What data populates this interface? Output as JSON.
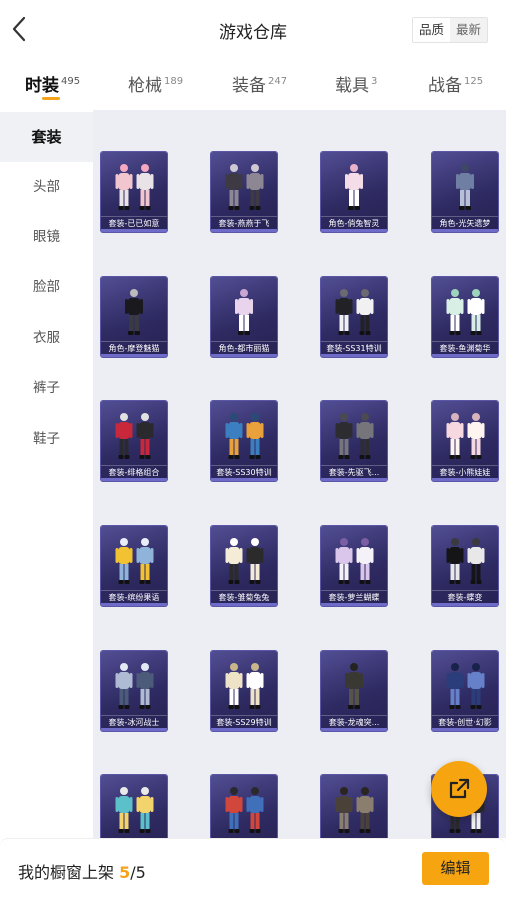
{
  "header": {
    "title": "游戏仓库",
    "sort_options": [
      "品质",
      "最新"
    ],
    "active_sort": 0
  },
  "tabs": [
    {
      "label": "时装",
      "count": "495",
      "active": true
    },
    {
      "label": "枪械",
      "count": "189",
      "active": false
    },
    {
      "label": "装备",
      "count": "247",
      "active": false
    },
    {
      "label": "载具",
      "count": "3",
      "active": false
    },
    {
      "label": "战备",
      "count": "125",
      "active": false
    }
  ],
  "sidebar": {
    "items": [
      {
        "label": "套装",
        "active": true
      },
      {
        "label": "头部",
        "active": false
      },
      {
        "label": "眼镜",
        "active": false
      },
      {
        "label": "脸部",
        "active": false
      },
      {
        "label": "衣服",
        "active": false
      },
      {
        "label": "裤子",
        "active": false
      },
      {
        "label": "鞋子",
        "active": false
      }
    ]
  },
  "items": [
    {
      "label": "套装-已已如意",
      "icon": "twin-outfit-pink"
    },
    {
      "label": "套装-燕燕于飞",
      "icon": "twin-outfit-dark"
    },
    {
      "label": "角色-俏兔智灵",
      "icon": "single-character-bunny"
    },
    {
      "label": "角色-光矢遗梦",
      "icon": "single-character-knight"
    },
    {
      "label": "角色-摩登魅猫",
      "icon": "single-character-black-cat"
    },
    {
      "label": "角色-都市丽猫",
      "icon": "single-character-dress"
    },
    {
      "label": "套装-SS31特训",
      "icon": "twin-outfit-mono"
    },
    {
      "label": "套装-鱼渊菊华",
      "icon": "twin-outfit-mint"
    },
    {
      "label": "套装-绯格组合",
      "icon": "outfit-set-red"
    },
    {
      "label": "套装-SS30特训",
      "icon": "twin-outfit-blue"
    },
    {
      "label": "套装-先驱飞...",
      "icon": "twin-outfit-armor"
    },
    {
      "label": "套装-小熊娃娃",
      "icon": "twin-outfit-pastel"
    },
    {
      "label": "套装-缤纷果语",
      "icon": "outfit-set-yellow"
    },
    {
      "label": "套装-雏菊兔兔",
      "icon": "twin-outfit-cream"
    },
    {
      "label": "套装-萝兰蝴蝶",
      "icon": "twin-outfit-lilac"
    },
    {
      "label": "套装-蝶变",
      "icon": "twin-outfit-black"
    },
    {
      "label": "套装-冰河战士",
      "icon": "twin-outfit-ice"
    },
    {
      "label": "套装-SS29特训",
      "icon": "outfit-set-beige"
    },
    {
      "label": "套装-龙魂突...",
      "icon": "single-character-soldier"
    },
    {
      "label": "套装-创世·幻影",
      "icon": "twin-outfit-navy"
    },
    {
      "label": "",
      "icon": "twin-outfit-teal"
    },
    {
      "label": "",
      "icon": "twin-outfit-redblue"
    },
    {
      "label": "",
      "icon": "outfit-set-jacket"
    },
    {
      "label": "",
      "icon": "outfit-set-shoes"
    }
  ],
  "bottom": {
    "prefix": "我的橱窗上架 ",
    "current": "5",
    "separator": "/",
    "total": "5",
    "edit_label": "编辑"
  },
  "colors": {
    "accent": "#f6a511",
    "card_bg": "#2f2b63",
    "content_bg": "#eceef3"
  }
}
